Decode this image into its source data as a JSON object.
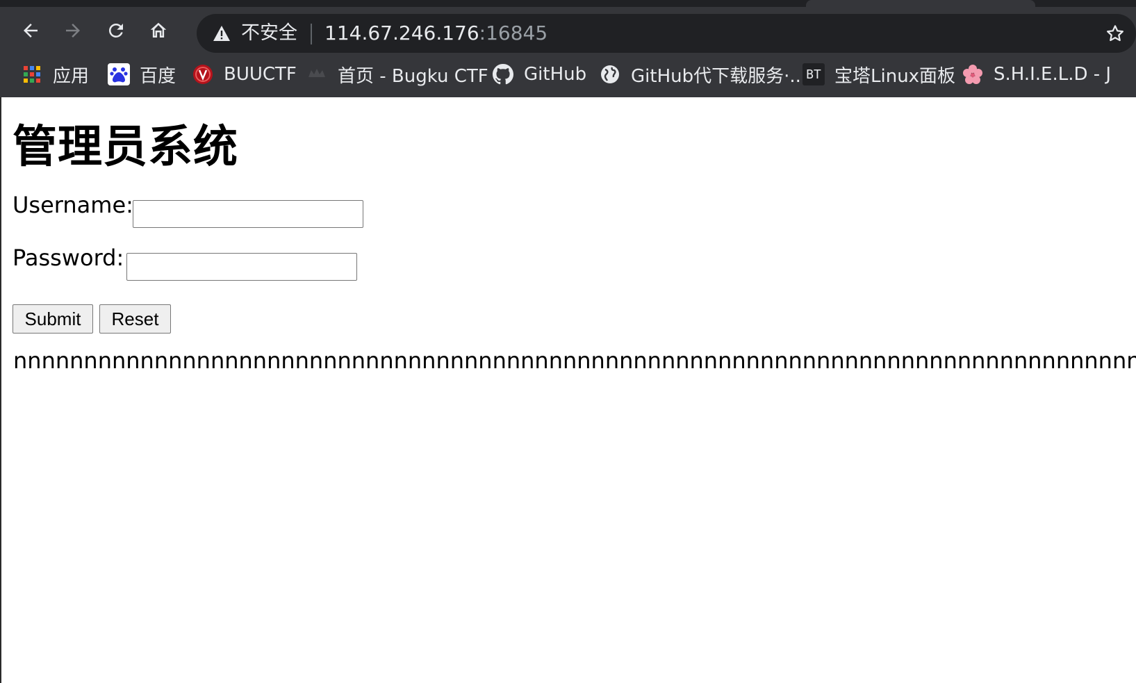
{
  "browser": {
    "security_label": "不安全",
    "url_host": "114.67.246.176",
    "url_port": ":16845"
  },
  "bookmarks": [
    {
      "label": "应用",
      "icon": "apps-grid-icon"
    },
    {
      "label": "百度",
      "icon": "baidu-paw-icon"
    },
    {
      "label": "BUUCTF",
      "icon": "buuctf-logo-icon"
    },
    {
      "label": "首页 - Bugku CTF",
      "icon": "bugku-logo-icon"
    },
    {
      "label": "GitHub",
      "icon": "github-icon"
    },
    {
      "label": "GitHub代下载服务·...",
      "icon": "globe-icon"
    },
    {
      "label": "宝塔Linux面板",
      "icon": "bt-panel-icon"
    },
    {
      "label": "S.H.I.E.L.D - J",
      "icon": "sakura-flower-icon"
    }
  ],
  "bt_icon_text": "BT",
  "page": {
    "title": "管理员系统",
    "username_label": "Username:",
    "username_value": "",
    "password_label": "Password:",
    "password_value": "",
    "submit_label": "Submit",
    "reset_label": "Reset",
    "output_text": "nnnnnnnnnnnnnnnnnnnnnnnnnnnnnnnnnnnnnnnnnnnnnnnnnnnnnnnnnnnnnnnnnnnnnnnnnnnnnnnnnnnnnnnnnnnnnnnnnnnnnnnnnnnnnnnnn"
  }
}
